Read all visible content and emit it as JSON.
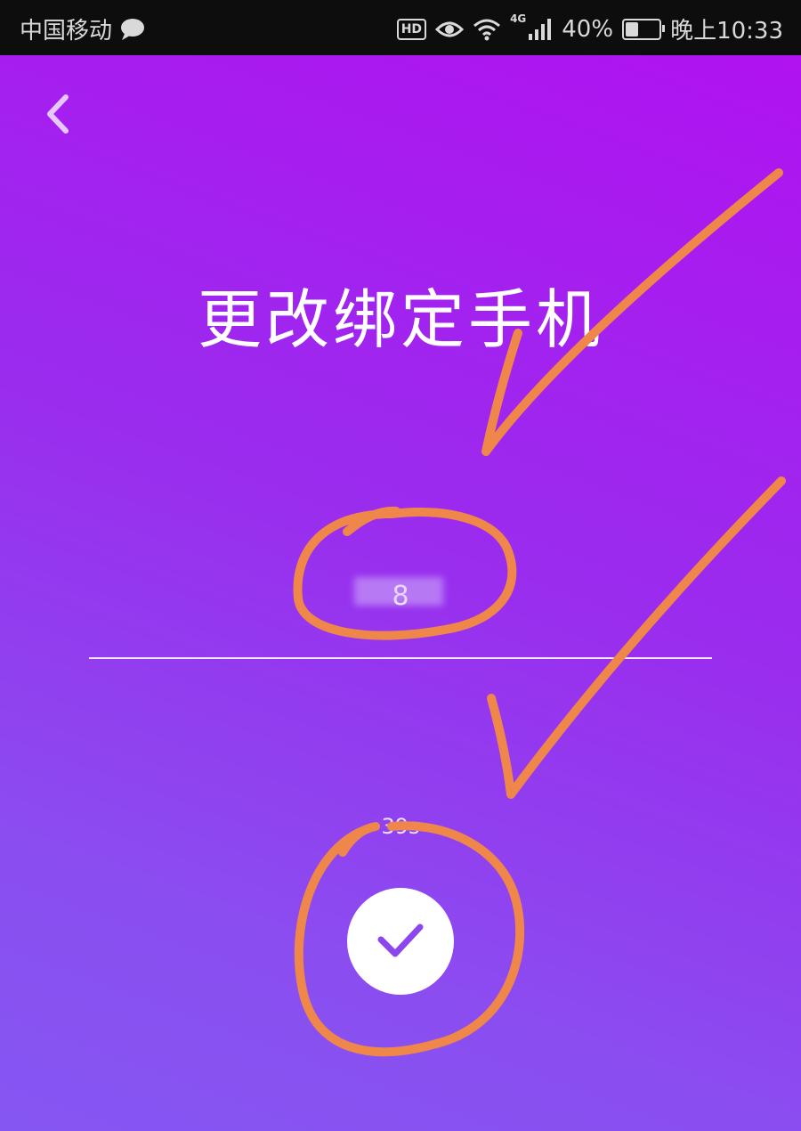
{
  "status_bar": {
    "carrier": "中国移动",
    "hd": "HD",
    "network": "4G",
    "battery_percent": "40%",
    "battery_level": 0.4,
    "time": "晚上10:33"
  },
  "page": {
    "title": "更改绑定手机",
    "phone_value": "8",
    "countdown": "39s"
  },
  "colors": {
    "gradient_top": "#b012f0",
    "gradient_bottom": "#8556f2",
    "annotation": "#f0874a",
    "accent": "#8b46ee"
  },
  "icons": {
    "back": "chevron-left-icon",
    "confirm": "check-icon",
    "chat": "chat-bubble-icon",
    "eye": "eye-icon",
    "wifi": "wifi-icon",
    "signal": "signal-icon",
    "battery": "battery-icon"
  }
}
